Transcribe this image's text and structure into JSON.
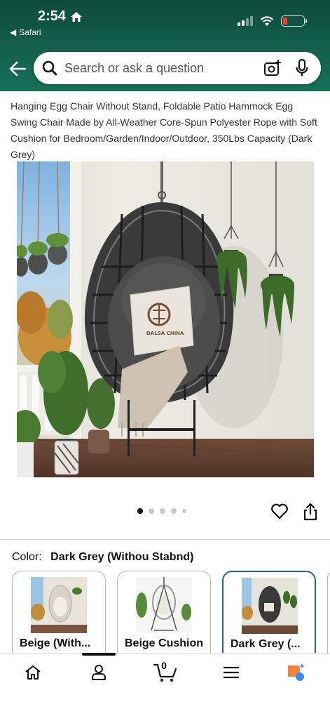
{
  "status_bar": {
    "time": "2:54",
    "back_app": "Safari",
    "battery_color": "#ff3b30"
  },
  "search": {
    "placeholder": "Search or ask a question",
    "icons": [
      "back-arrow-icon",
      "search-icon",
      "camera-icon",
      "microphone-icon"
    ]
  },
  "product": {
    "title": "Hanging Egg Chair Without Stand, Foldable Patio Hammock Egg Swing Chair Made by All-Weather Core-Spun Polyester Rope with Soft Cushion for Bedroom/Garden/Indoor/Outdoor, 350Lbs Capacity (Dark Grey)",
    "pillow_logo_text": "DALSA CHINA",
    "image_count": 5,
    "active_image_index": 0
  },
  "color": {
    "label": "Color:",
    "value": "Dark Grey (Withou Stabnd)",
    "options": [
      {
        "label": "Beige (With...",
        "selected": false
      },
      {
        "label": "Beige Cushion",
        "selected": false
      },
      {
        "label": "Dark Grey (...",
        "selected": true
      }
    ]
  },
  "bottom_nav": {
    "items": [
      "home-icon",
      "account-icon",
      "cart-icon",
      "menu-icon",
      "rufus-icon"
    ],
    "cart_count": "0",
    "active_index": 1
  },
  "colors": {
    "header_dark": "#0f4a3b",
    "header_light": "#17705a",
    "selected_border": "#2162a1",
    "rufus_orange": "#f3823a",
    "rufus_blue": "#3d8af7"
  }
}
